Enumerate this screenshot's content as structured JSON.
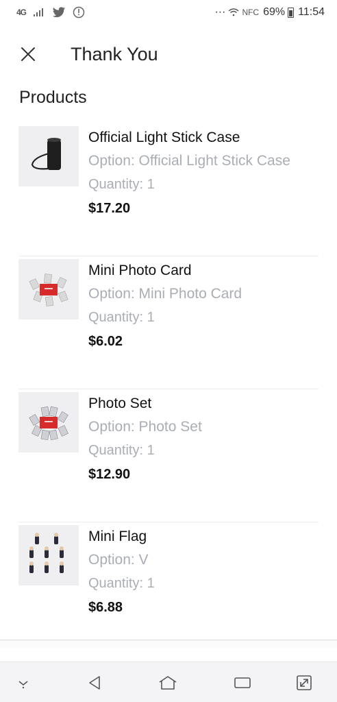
{
  "status_bar": {
    "network": "4G",
    "battery": "69%",
    "time": "11:54",
    "more": "···",
    "nfc": "NFC"
  },
  "header": {
    "title": "Thank You"
  },
  "section": {
    "title": "Products"
  },
  "products": [
    {
      "name": "Official Light Stick Case",
      "option": "Option: Official Light Stick Case",
      "quantity": "Quantity: 1",
      "price": "$17.20",
      "thumb_icon": "light-stick-case-icon"
    },
    {
      "name": "Mini Photo Card",
      "option": "Option: Mini Photo Card",
      "quantity": "Quantity: 1",
      "price": "$6.02",
      "thumb_icon": "photo-card-icon"
    },
    {
      "name": "Photo Set",
      "option": "Option: Photo Set",
      "quantity": "Quantity: 1",
      "price": "$12.90",
      "thumb_icon": "photo-set-icon"
    },
    {
      "name": "Mini Flag",
      "option": "Option: V",
      "quantity": "Quantity: 1",
      "price": "$6.88",
      "thumb_icon": "mini-flag-icon"
    }
  ],
  "colors": {
    "text_primary": "#111111",
    "text_secondary": "#a9adb4",
    "thumb_bg": "#efeff1",
    "accent_red": "#d62b2b"
  }
}
